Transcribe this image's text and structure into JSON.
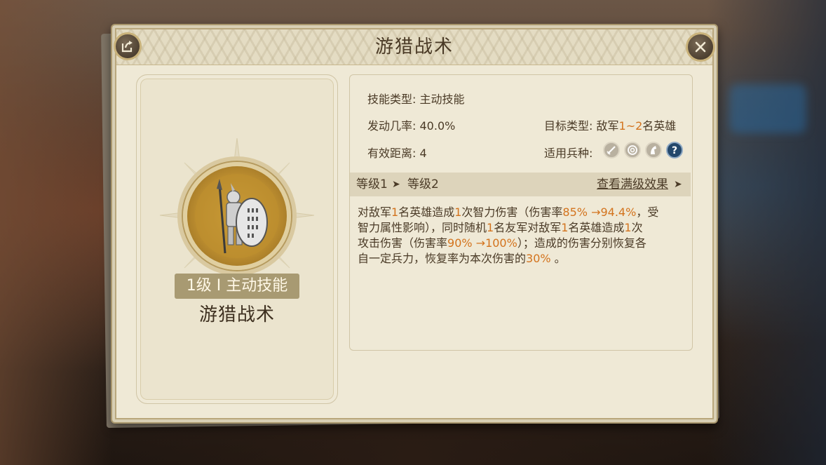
{
  "window": {
    "title": "游猎战术",
    "share_icon": "share-icon",
    "close_icon": "close-icon"
  },
  "skill_card": {
    "level_badge": "1级 I 主动技能",
    "name": "游猎战术",
    "portrait_icon": "spearman-shield-icon"
  },
  "info": {
    "skill_type_label": "技能类型:",
    "skill_type_value": "主动技能",
    "trigger_rate_label": "发动几率:",
    "trigger_rate_value": "40.0%",
    "target_type_label": "目标类型:",
    "target_type_prefix": "敌军",
    "target_type_range": "1~2",
    "target_type_suffix": "名英雄",
    "range_label": "有效距离:",
    "range_value": "4",
    "unit_types_label": "适用兵种:",
    "unit_types": [
      "sword-icon",
      "bow-icon",
      "horse-icon",
      "question-icon"
    ]
  },
  "level": {
    "current": "等级1",
    "arrow": "➤",
    "next": "等级2",
    "view_max_link": "查看满级效果",
    "view_max_arrow": "➤"
  },
  "description": {
    "line1": [
      {
        "t": "对敌军",
        "hl": false
      },
      {
        "t": "1",
        "hl": true
      },
      {
        "t": "名英雄造成",
        "hl": false
      },
      {
        "t": "1",
        "hl": true
      },
      {
        "t": "次智力伤害（伤害率",
        "hl": false
      },
      {
        "t": "85% →94.4%",
        "hl": true
      },
      {
        "t": "，受",
        "hl": false
      }
    ],
    "line2": [
      {
        "t": "智力属性影响），同时随机",
        "hl": false
      },
      {
        "t": "1",
        "hl": true
      },
      {
        "t": "名友军对敌军",
        "hl": false
      },
      {
        "t": "1",
        "hl": true
      },
      {
        "t": "名英雄造成",
        "hl": false
      },
      {
        "t": "1",
        "hl": true
      },
      {
        "t": "次",
        "hl": false
      }
    ],
    "line3": [
      {
        "t": "攻击伤害（伤害率",
        "hl": false
      },
      {
        "t": "90% →100%",
        "hl": true
      },
      {
        "t": "）；造成的伤害分别恢复各",
        "hl": false
      }
    ],
    "line4": [
      {
        "t": "自一定兵力，恢复率为本次伤害的",
        "hl": false
      },
      {
        "t": "30%",
        "hl": true
      },
      {
        "t": " 。",
        "hl": false
      }
    ]
  },
  "colors": {
    "highlight": "#d3731d",
    "text": "#4a3a26",
    "panel": "#efe9d6"
  }
}
